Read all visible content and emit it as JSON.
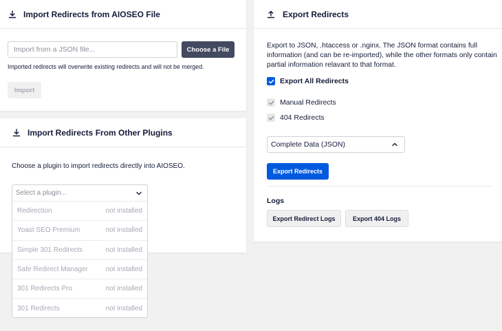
{
  "import_aioseo": {
    "title": "Import Redirects from AIOSEO File",
    "file_placeholder": "Import from a JSON file...",
    "choose_label": "Choose a File",
    "note": "Imported redirects will overwrite existing redirects and will not be merged.",
    "import_label": "Import"
  },
  "import_plugins": {
    "title": "Import Redirects From Other Plugins",
    "description": "Choose a plugin to import redirects directly into AIOSEO.",
    "select_placeholder": "Select a plugin...",
    "options": [
      {
        "name": "Redirection",
        "status": "not installed"
      },
      {
        "name": "Yoast SEO Premium",
        "status": "not installed"
      },
      {
        "name": "Simple 301 Redirects",
        "status": "not installed"
      },
      {
        "name": "Safe Redirect Manager",
        "status": "not installed"
      },
      {
        "name": "301 Redirects Pro",
        "status": "not installed"
      },
      {
        "name": "301 Redirects",
        "status": "not installed"
      }
    ]
  },
  "export": {
    "title": "Export Redirects",
    "description": "Export to JSON, .htaccess or .nginx. The JSON format contains full information (and can be re-imported), while the other formats only contain partial information relavant to that format.",
    "all_label": "Export All Redirects",
    "all_checked": true,
    "manual_label": "Manual Redirects",
    "manual_checked": true,
    "r404_label": "404 Redirects",
    "r404_checked": true,
    "format_value": "Complete Data (JSON)",
    "export_label": "Export Redirects",
    "logs_title": "Logs",
    "redirect_logs_label": "Export Redirect Logs",
    "logs404_label": "Export 404 Logs"
  },
  "colors": {
    "primary": "#005ae0",
    "dark_button": "#434960",
    "text": "#141b38"
  }
}
